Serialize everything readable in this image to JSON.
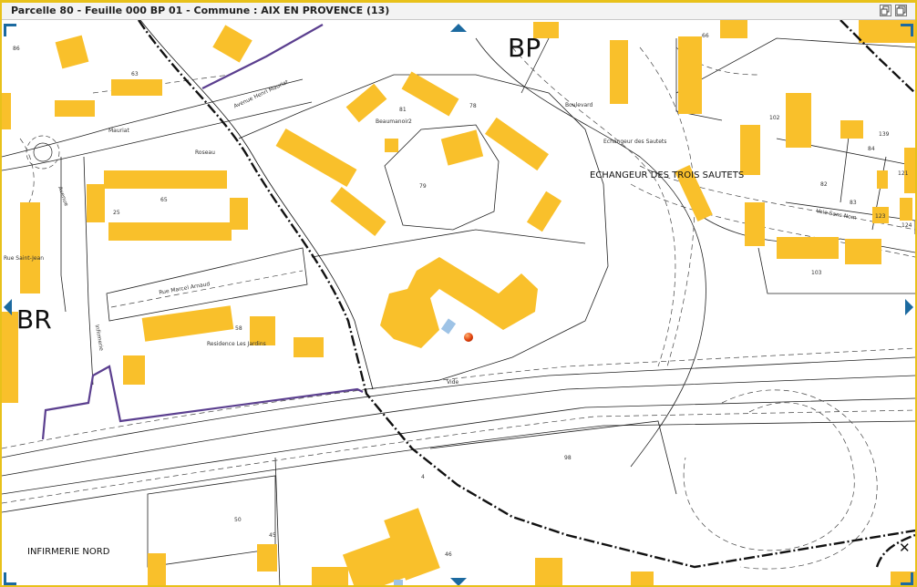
{
  "window": {
    "title": "Parcelle 80 - Feuille 000 BP 01 - Commune : AIX EN PROVENCE (13)",
    "buttons": {
      "restore_icon": "restore-window-icon",
      "maximize_icon": "maximize-window-icon"
    }
  },
  "map": {
    "section_labels": [
      "BP",
      "BR"
    ],
    "place_labels": [
      "ECHANGEUR DES TROIS SAUTETS",
      "INFIRMERIE NORD"
    ],
    "parcel_numbers": [
      "86",
      "63",
      "65",
      "25",
      "66",
      "102",
      "139",
      "84",
      "121",
      "82",
      "83",
      "123",
      "124",
      "103",
      "81",
      "78",
      "79",
      "58",
      "98",
      "50",
      "45",
      "46",
      "2",
      "4"
    ],
    "street_labels": [
      "Avenue Henri Mauriat",
      "Rue Marcel Arnaud",
      "Beaumanoir",
      "Mauriat",
      "Infirmerie",
      "Avenue",
      "Voie Sans Nom",
      "Vide",
      "Residence Les Jardins",
      "Echangeur des Sautets",
      "Rue Saint-Jean",
      "Roseau",
      "Boulevard"
    ],
    "colors": {
      "building": "#f9c02b",
      "commune_boundary": "#5b3f8f",
      "section_boundary": "#111111",
      "window_border": "#e8c11a",
      "nav_arrow": "#1c6aa0",
      "marker": "#e0400a"
    },
    "close_icon": "close-icon",
    "marker_icon": "location-marker-icon",
    "nav_arrows": [
      "nav-arrow-up-icon",
      "nav-arrow-down-icon",
      "nav-arrow-left-icon",
      "nav-arrow-right-icon"
    ]
  }
}
